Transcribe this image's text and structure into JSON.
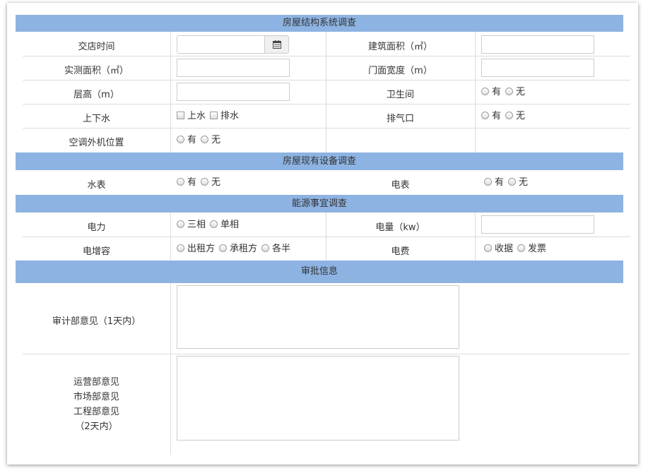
{
  "sections": {
    "structure": "房屋结构系统调查",
    "equipment": "房屋现有设备调查",
    "energy": "能源事宜调查",
    "approval": "审批信息"
  },
  "labels": {
    "shop_handover_time": "交店时间",
    "building_area": "建筑面积（㎡）",
    "measured_area": "实测面积（㎡）",
    "frontage_width": "门面宽度（m）",
    "floor_height": "层高（m）",
    "restroom": "卫生间",
    "water_supply_drain": "上下水",
    "exhaust_vent": "排气口",
    "ac_outdoor_position": "空调外机位置",
    "water_meter": "水表",
    "electric_meter": "电表",
    "power": "电力",
    "electric_capacity": "电量（kw）",
    "capacity_increase": "电增容",
    "electric_fee": "电费",
    "audit_opinion": "审计部意见（1天内）",
    "ops_opinion_1": "运营部意见",
    "ops_opinion_2": "市场部意见",
    "ops_opinion_3": "工程部意见",
    "ops_opinion_4": "（2天内）"
  },
  "options": {
    "yes": "有",
    "no": "无",
    "water_up": "上水",
    "water_drain": "排水",
    "three_phase": "三相",
    "single_phase": "单相",
    "by_lessor": "出租方",
    "by_lessee": "承租方",
    "half_each": "各半",
    "receipt": "收据",
    "invoice": "发票"
  },
  "icons": {
    "date_picker": "calendar-icon"
  },
  "colors": {
    "section_header": "#8db3e2",
    "grid_line": "#dcdcdc",
    "input_border": "#cccccc"
  }
}
